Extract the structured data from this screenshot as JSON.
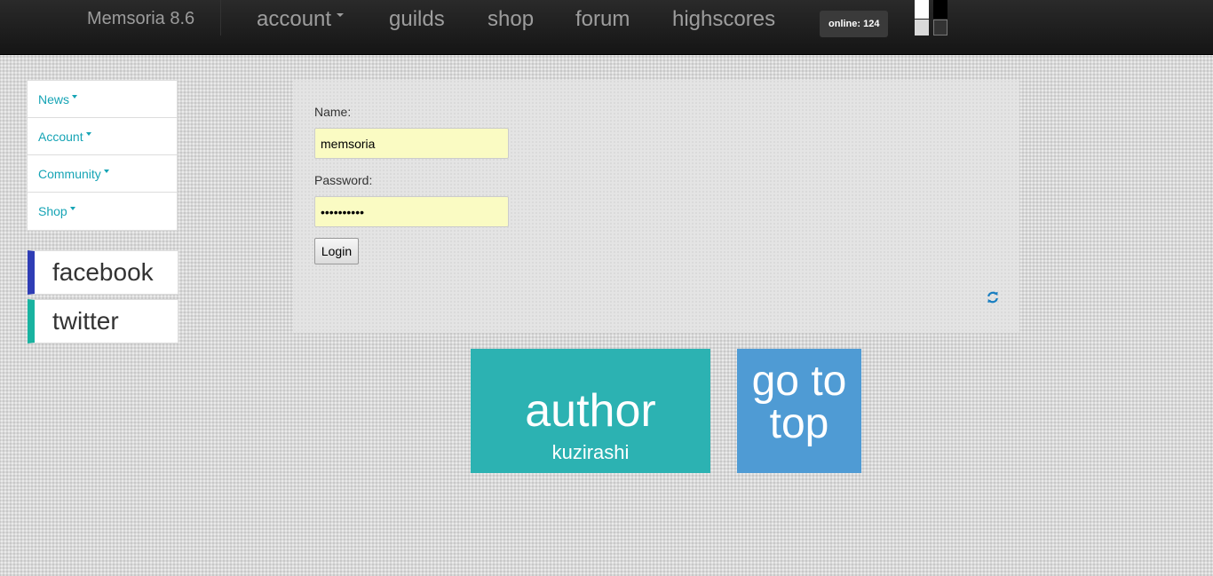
{
  "navbar": {
    "brand": "Memsoria 8.6",
    "links": [
      {
        "label": "account",
        "dropdown": true
      },
      {
        "label": "guilds"
      },
      {
        "label": "shop"
      },
      {
        "label": "forum"
      },
      {
        "label": "highscores"
      }
    ],
    "online": "online: 124",
    "theme_swatches": [
      "#ffffff",
      "#000000",
      "#d9d9d9",
      "#333333"
    ]
  },
  "sidebar": {
    "items": [
      {
        "label": "News"
      },
      {
        "label": "Account"
      },
      {
        "label": "Community"
      },
      {
        "label": "Shop"
      }
    ]
  },
  "social": {
    "facebook": {
      "label": "facebook",
      "color": "#2f3db5"
    },
    "twitter": {
      "label": "twitter",
      "color": "#19b3a0"
    }
  },
  "login": {
    "name_label": "Name:",
    "name_value": "memsoria",
    "password_label": "Password:",
    "password_value": "••••••••••",
    "button": "Login",
    "refresh_icon": "refresh-icon"
  },
  "tiles": {
    "author": {
      "title": "author",
      "subtitle": "kuzirashi",
      "color": "#2cb2b2"
    },
    "top": {
      "line1": "go to",
      "line2": "top",
      "color": "#4f9bd4"
    }
  },
  "colors": {
    "accent": "#16a4b5",
    "field_bg": "#fafbc3"
  }
}
